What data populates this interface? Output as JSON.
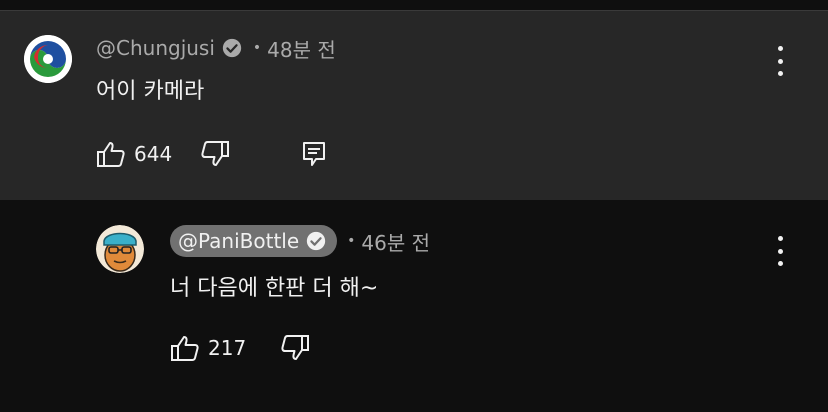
{
  "comment": {
    "handle": "@Chungjusi",
    "time": "48분 전",
    "text": "어이 카메라",
    "likes": "644",
    "avatar_icon": "city-logo-icon"
  },
  "reply": {
    "handle": "@PaniBottle",
    "time": "46분 전",
    "text": "너 다음에 한판 더 해~",
    "likes": "217",
    "avatar_icon": "cartoon-face-avatar-icon"
  },
  "separator": "•",
  "colors": {
    "comment_bg": "#272727",
    "page_bg": "#0f0f0f",
    "muted_text": "#aaaaaa",
    "chip_bg": "#717171"
  }
}
